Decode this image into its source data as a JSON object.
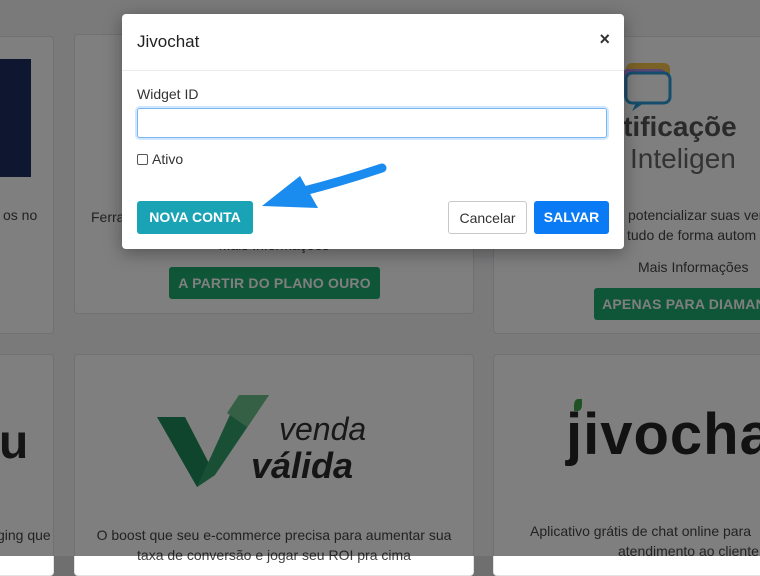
{
  "modal": {
    "title": "Jivochat",
    "close_icon": "×",
    "widget_label": "Widget ID",
    "widget_value": "",
    "active_label": "Ativo",
    "new_account": "NOVA CONTA",
    "cancel": "Cancelar",
    "save": "SALVAR"
  },
  "background": {
    "card_left_top": {
      "text": "os no"
    },
    "card_center_top": {
      "text": "Ferra",
      "more": "Mais Informações",
      "plan_button": "A PARTIR DO PLANO OURO"
    },
    "card_right_top": {
      "logo_line1": "otificaçõe",
      "logo_line2": "Inteligen",
      "text_line1": "potencializar suas ven",
      "text_line2": "tudo de forma autom",
      "more": "Mais Informações",
      "plan_button": "APENAS PARA DIAMAN"
    },
    "card_left_bottom": {
      "logo": "u",
      "text": "ging que"
    },
    "card_center_bottom": {
      "logo_line1": "venda",
      "logo_line2": "válida",
      "text_line1": "O boost que seu e-commerce precisa para aumentar sua",
      "text_line2": "taxa de conversão e jogar seu ROI pra cima"
    },
    "card_right_bottom": {
      "logo": "jivochat",
      "text_line1": "Aplicativo grátis de chat online para",
      "text_line2": "atendimento ao cliente"
    }
  },
  "colors": {
    "plan_green": "#1eaa6e",
    "nova_teal": "#19a3b5",
    "save_blue": "#0a7bf5",
    "arrow_blue": "#1a8cf0"
  }
}
